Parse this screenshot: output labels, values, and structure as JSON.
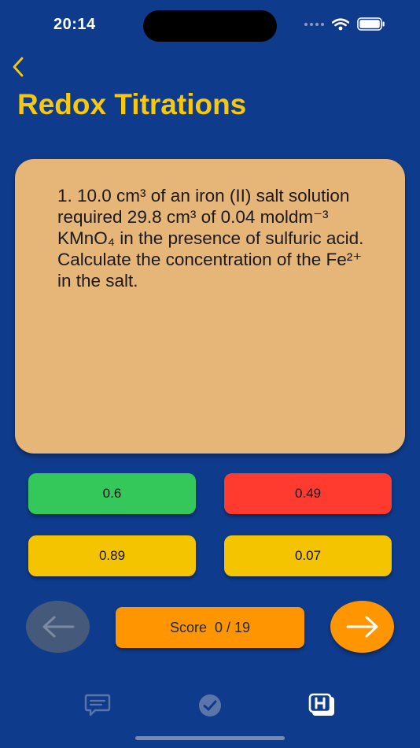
{
  "status_bar": {
    "time": "20:14"
  },
  "header": {
    "title": "Redox Titrations"
  },
  "question": {
    "text": "1. 10.0 cm³ of an iron (II) salt solution required 29.8 cm³ of 0.04 moldm⁻³ KMnO₄ in the presence of sulfuric acid. Calculate the concentration of the Fe²⁺ in the salt."
  },
  "answers": [
    {
      "label": "0.6",
      "state": "correct",
      "color": "#34c759"
    },
    {
      "label": "0.49",
      "state": "wrong",
      "color": "#ff3b30"
    },
    {
      "label": "0.89",
      "state": "neutral",
      "color": "#f5c400"
    },
    {
      "label": "0.07",
      "state": "neutral",
      "color": "#f5c400"
    }
  ],
  "navigation": {
    "score_label": "Score",
    "score_value": "0 / 19"
  },
  "tabs": [
    {
      "icon": "chat-icon"
    },
    {
      "icon": "checkmark-circle-icon"
    },
    {
      "icon": "h-logo-icon",
      "selected": true
    }
  ],
  "colors": {
    "background": "#0f3b8c",
    "title": "#f6c90e",
    "card": "#e6b578",
    "accent": "#ff9500"
  }
}
